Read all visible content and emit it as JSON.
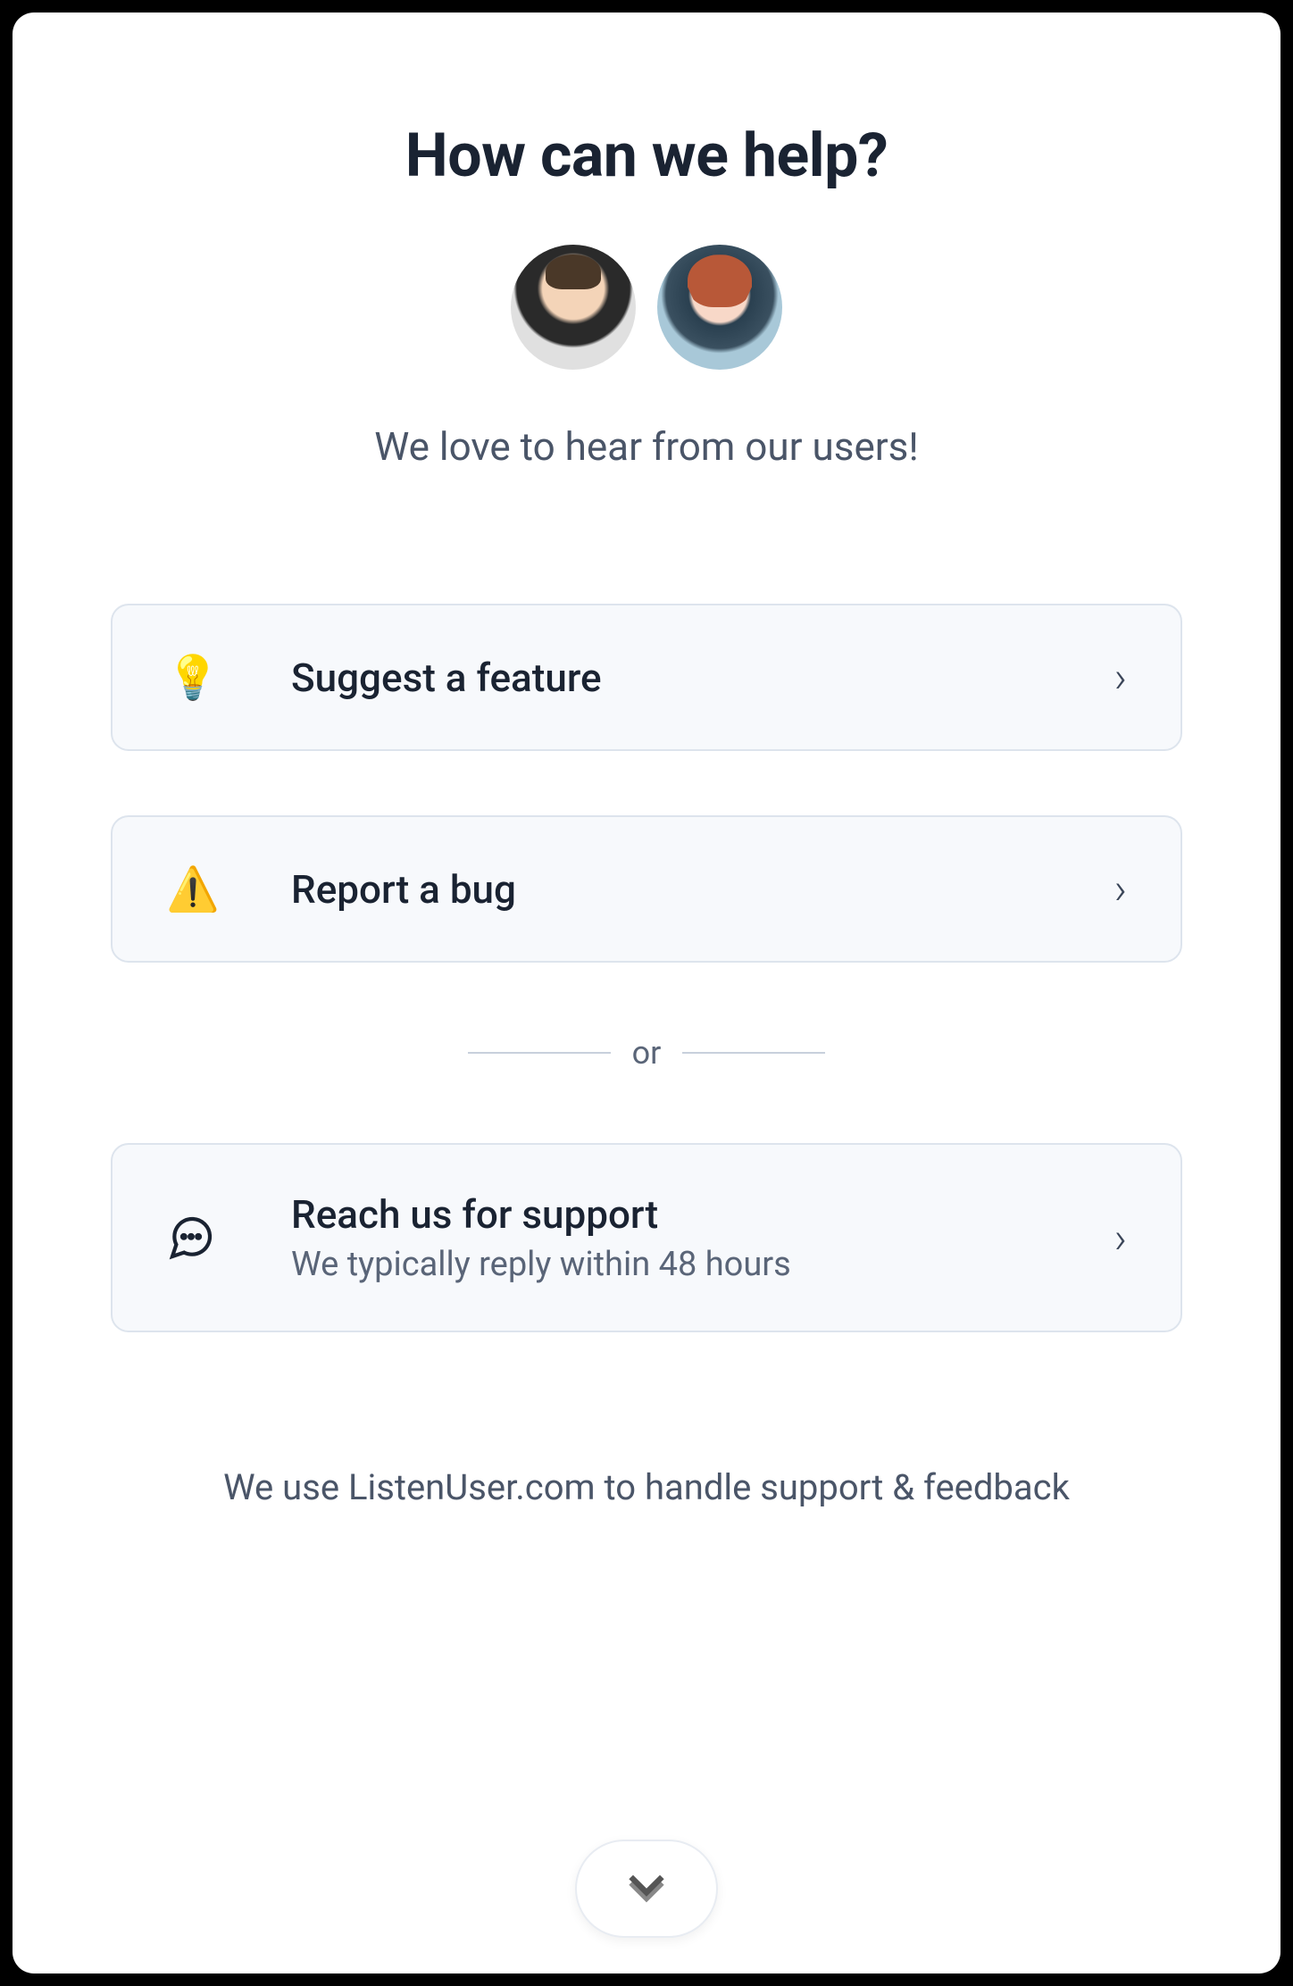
{
  "header": {
    "title": "How can we help?",
    "subtitle": "We love to hear from our users!"
  },
  "options": {
    "suggest": {
      "icon": "💡",
      "label": "Suggest a feature"
    },
    "bug": {
      "icon": "⚠️",
      "label": "Report a bug"
    },
    "divider": "or",
    "support": {
      "label": "Reach us for support",
      "sublabel": "We typically reply within 48 hours"
    }
  },
  "footer": {
    "text": "We use ListenUser.com to handle support & feedback"
  }
}
